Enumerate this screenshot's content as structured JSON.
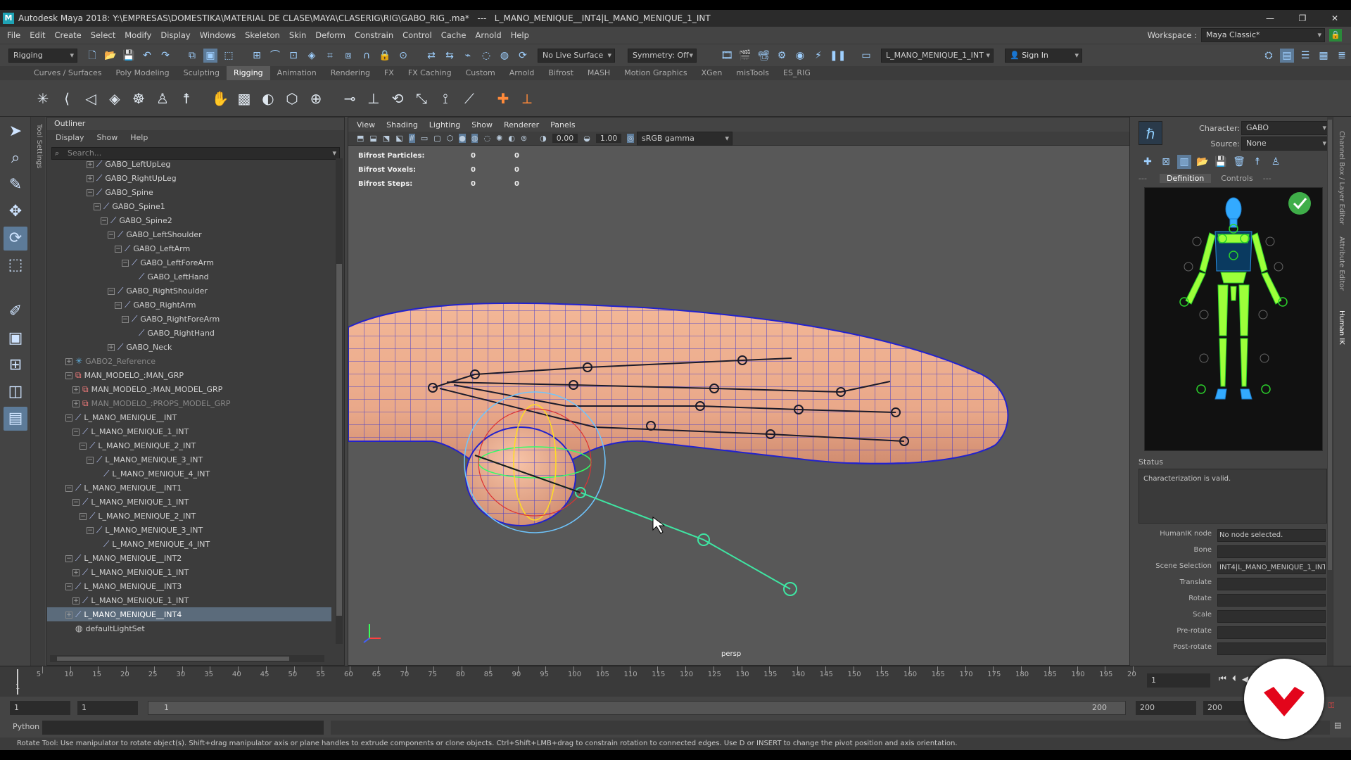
{
  "window": {
    "title": "Autodesk Maya 2018: Y:\\EMPRESAS\\DOMESTIKA\\MATERIAL DE CLASE\\MAYA\\CLASERIG\\RIG\\GABO_RIG_.ma*   ---   L_MANO_MENIQUE__INT4|L_MANO_MENIQUE_1_INT"
  },
  "menu": [
    "File",
    "Edit",
    "Create",
    "Select",
    "Modify",
    "Display",
    "Windows",
    "Skeleton",
    "Skin",
    "Deform",
    "Constrain",
    "Control",
    "Cache",
    "Arnold",
    "Help"
  ],
  "workspace": {
    "label": "Workspace :",
    "value": "Maya Classic*"
  },
  "statusline": {
    "mode": "Rigging",
    "live_surface": "No Live Surface",
    "symmetry": "Symmetry: Off",
    "selection_field": "L_MANO_MENIQUE_1_INT",
    "sign_in": "Sign In"
  },
  "shelf_tabs": [
    "Curves / Surfaces",
    "Poly Modeling",
    "Sculpting",
    "Rigging",
    "Animation",
    "Rendering",
    "FX",
    "FX Caching",
    "Custom",
    "Arnold",
    "Bifrost",
    "MASH",
    "Motion Graphics",
    "XGen",
    "misTools",
    "ES_RIG"
  ],
  "shelf_active": "Rigging",
  "outliner": {
    "title": "Outliner",
    "menu": [
      "Display",
      "Show",
      "Help"
    ],
    "search_placeholder": "Search...",
    "nodes": [
      {
        "label": "GABO_LeftUpLeg",
        "depth": 5,
        "ex": "+",
        "icon": "joint"
      },
      {
        "label": "GABO_RightUpLeg",
        "depth": 5,
        "ex": "+",
        "icon": "joint"
      },
      {
        "label": "GABO_Spine",
        "depth": 5,
        "ex": "-",
        "icon": "joint"
      },
      {
        "label": "GABO_Spine1",
        "depth": 6,
        "ex": "-",
        "icon": "joint"
      },
      {
        "label": "GABO_Spine2",
        "depth": 7,
        "ex": "-",
        "icon": "joint"
      },
      {
        "label": "GABO_LeftShoulder",
        "depth": 8,
        "ex": "-",
        "icon": "joint"
      },
      {
        "label": "GABO_LeftArm",
        "depth": 9,
        "ex": "-",
        "icon": "joint"
      },
      {
        "label": "GABO_LeftForeArm",
        "depth": 10,
        "ex": "-",
        "icon": "joint"
      },
      {
        "label": "GABO_LeftHand",
        "depth": 11,
        "ex": "",
        "icon": "joint"
      },
      {
        "label": "GABO_RightShoulder",
        "depth": 8,
        "ex": "-",
        "icon": "joint"
      },
      {
        "label": "GABO_RightArm",
        "depth": 9,
        "ex": "-",
        "icon": "joint"
      },
      {
        "label": "GABO_RightForeArm",
        "depth": 10,
        "ex": "-",
        "icon": "joint"
      },
      {
        "label": "GABO_RightHand",
        "depth": 11,
        "ex": "",
        "icon": "joint"
      },
      {
        "label": "GABO_Neck",
        "depth": 8,
        "ex": "+",
        "icon": "joint"
      },
      {
        "label": "GABO2_Reference",
        "depth": 2,
        "ex": "+",
        "icon": "hik",
        "dim": true
      },
      {
        "label": "MAN_MODELO_:MAN_GRP",
        "depth": 2,
        "ex": "-",
        "icon": "group"
      },
      {
        "label": "MAN_MODELO_:MAN_MODEL_GRP",
        "depth": 3,
        "ex": "+",
        "icon": "group"
      },
      {
        "label": "MAN_MODELO_:PROPS_MODEL_GRP",
        "depth": 3,
        "ex": "+",
        "icon": "group",
        "dim": true
      },
      {
        "label": "L_MANO_MENIQUE__INT",
        "depth": 2,
        "ex": "-",
        "icon": "joint"
      },
      {
        "label": "L_MANO_MENIQUE_1_INT",
        "depth": 3,
        "ex": "-",
        "icon": "joint"
      },
      {
        "label": "L_MANO_MENIQUE_2_INT",
        "depth": 4,
        "ex": "-",
        "icon": "joint"
      },
      {
        "label": "L_MANO_MENIQUE_3_INT",
        "depth": 5,
        "ex": "-",
        "icon": "joint"
      },
      {
        "label": "L_MANO_MENIQUE_4_INT",
        "depth": 6,
        "ex": "",
        "icon": "joint"
      },
      {
        "label": "L_MANO_MENIQUE__INT1",
        "depth": 2,
        "ex": "-",
        "icon": "joint"
      },
      {
        "label": "L_MANO_MENIQUE_1_INT",
        "depth": 3,
        "ex": "-",
        "icon": "joint"
      },
      {
        "label": "L_MANO_MENIQUE_2_INT",
        "depth": 4,
        "ex": "-",
        "icon": "joint"
      },
      {
        "label": "L_MANO_MENIQUE_3_INT",
        "depth": 5,
        "ex": "-",
        "icon": "joint"
      },
      {
        "label": "L_MANO_MENIQUE_4_INT",
        "depth": 6,
        "ex": "",
        "icon": "joint"
      },
      {
        "label": "L_MANO_MENIQUE__INT2",
        "depth": 2,
        "ex": "-",
        "icon": "joint"
      },
      {
        "label": "L_MANO_MENIQUE_1_INT",
        "depth": 3,
        "ex": "+",
        "icon": "joint"
      },
      {
        "label": "L_MANO_MENIQUE__INT3",
        "depth": 2,
        "ex": "-",
        "icon": "joint"
      },
      {
        "label": "L_MANO_MENIQUE_1_INT",
        "depth": 3,
        "ex": "+",
        "icon": "joint"
      },
      {
        "label": "L_MANO_MENIQUE__INT4",
        "depth": 2,
        "ex": "+",
        "icon": "joint",
        "selected": true
      },
      {
        "label": "defaultLightSet",
        "depth": 2,
        "ex": "",
        "icon": "set"
      }
    ]
  },
  "viewport": {
    "menu": [
      "View",
      "Shading",
      "Lighting",
      "Show",
      "Renderer",
      "Panels"
    ],
    "exposure": "0.00",
    "gamma": "1.00",
    "color_space": "sRGB gamma",
    "hud": [
      {
        "label": "Bifrost Particles:",
        "a": "0",
        "b": "0"
      },
      {
        "label": "Bifrost Voxels:",
        "a": "0",
        "b": "0"
      },
      {
        "label": "Bifrost Steps:",
        "a": "0",
        "b": "0"
      }
    ],
    "camera": "persp"
  },
  "hik": {
    "character_label": "Character:",
    "character": "GABO",
    "source_label": "Source:",
    "source": "None",
    "tabs": [
      "Definition",
      "Controls"
    ],
    "status_title": "Status",
    "status_text": "Characterization is valid.",
    "props": [
      {
        "label": "HumanIK node",
        "value": "No node selected."
      },
      {
        "label": "Bone",
        "value": ""
      },
      {
        "label": "Scene Selection",
        "value": "INT4|L_MANO_MENIQUE_1_INT"
      },
      {
        "label": "Translate",
        "value": ""
      },
      {
        "label": "Rotate",
        "value": ""
      },
      {
        "label": "Scale",
        "value": ""
      },
      {
        "label": "Pre-rotate",
        "value": ""
      },
      {
        "label": "Post-rotate",
        "value": ""
      }
    ]
  },
  "right_tabs": [
    "Channel Box / Layer Editor",
    "Attribute Editor",
    "Human IK"
  ],
  "timeline": {
    "ticks": [
      "5",
      "10",
      "15",
      "20",
      "25",
      "30",
      "35",
      "40",
      "45",
      "50",
      "55",
      "60",
      "65",
      "70",
      "75",
      "80",
      "85",
      "90",
      "95",
      "100",
      "105",
      "110",
      "115",
      "120",
      "125",
      "130",
      "135",
      "140",
      "145",
      "150",
      "155",
      "160",
      "165",
      "170",
      "175",
      "180",
      "185",
      "190",
      "195",
      "20"
    ],
    "start_label": "1",
    "current_frame": "1"
  },
  "range": {
    "start": "1",
    "anim_start": "1",
    "slider_start": "1",
    "slider_end": "200",
    "end": "200",
    "anim_end": "200"
  },
  "cmd": {
    "label": "Python"
  },
  "help": "Rotate Tool: Use manipulator to rotate object(s). Shift+drag manipulator axis or plane handles to extrude components or clone objects. Ctrl+Shift+LMB+drag to constrain rotation to connected edges. Use D or INSERT to change the pivot position and axis orientation."
}
